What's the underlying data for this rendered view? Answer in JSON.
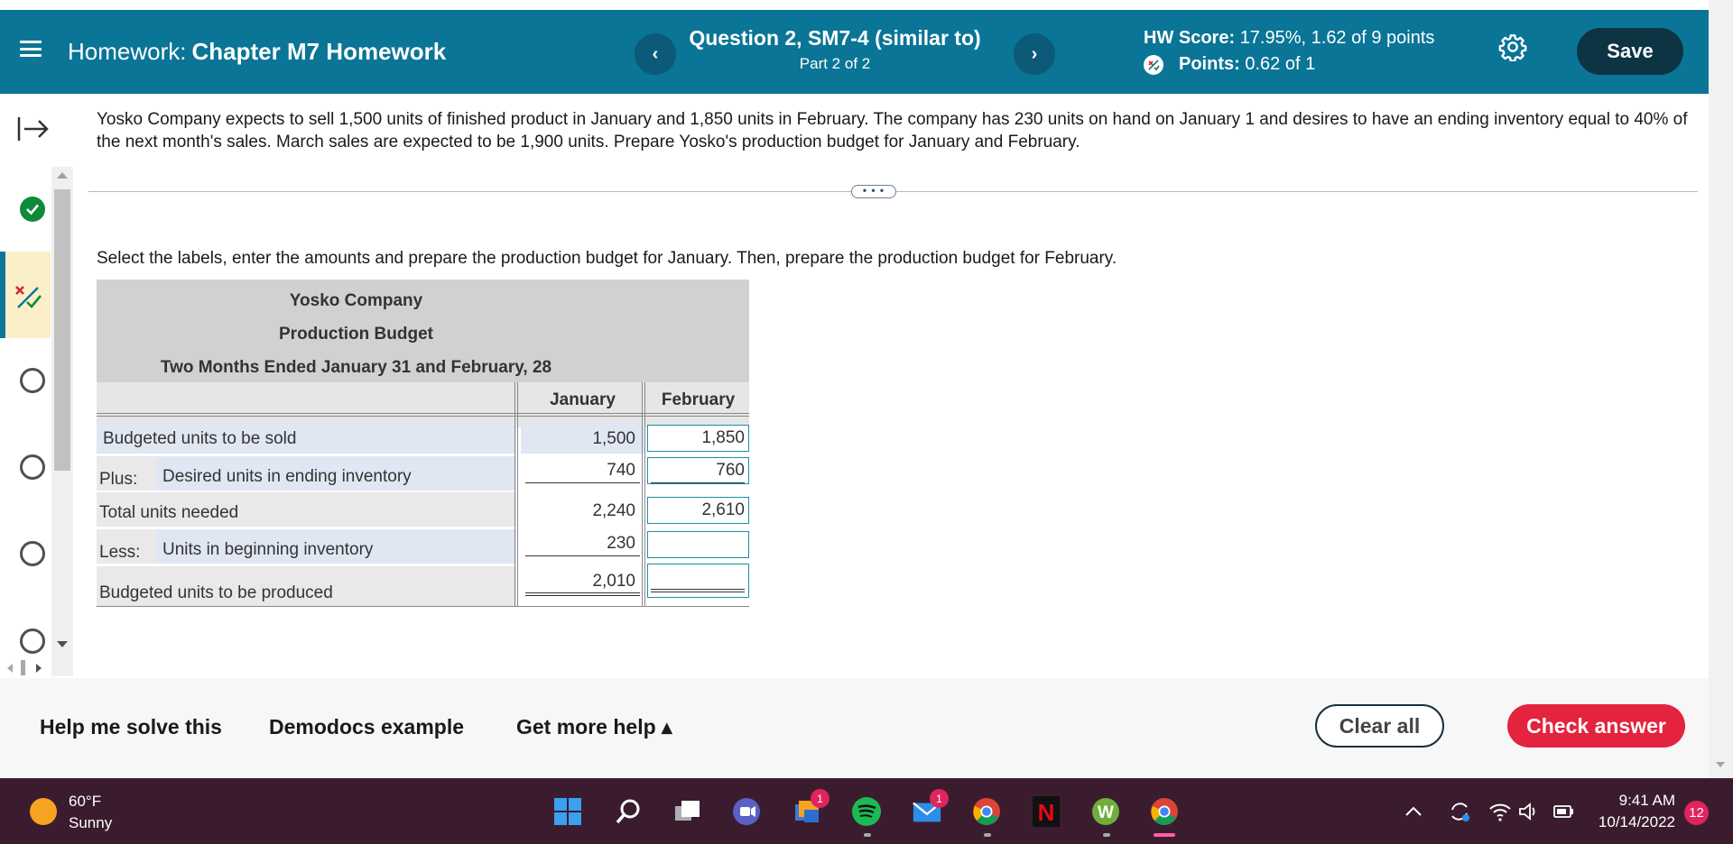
{
  "header": {
    "homework_prefix": "Homework:",
    "homework_name": "Chapter M7 Homework",
    "question_title": "Question 2, SM7-4 (similar to)",
    "question_part": "Part 2 of 2",
    "hw_score_label": "HW Score:",
    "hw_score_value": "17.95%, 1.62 of 9 points",
    "points_label": "Points:",
    "points_value": "0.62 of 1",
    "save_label": "Save",
    "prev_glyph": "‹",
    "next_glyph": "›",
    "accent_color": "#0a7596"
  },
  "sidebar": {
    "question_states": [
      "correct",
      "partial",
      "unanswered",
      "unanswered",
      "unanswered",
      "unanswered"
    ]
  },
  "problem": {
    "text": "Yosko Company expects to sell 1,500 units of finished product in January and 1,850 units in February. The company has 230 units on hand on January 1 and desires to have an ending inventory equal to 40% of the next month's sales. March sales are expected to be 1,900 units. Prepare Yosko's production budget for January and February.",
    "expand_glyph": "• • •",
    "instruction": "Select the labels, enter the amounts and prepare the production budget for January. Then, prepare the production budget for February."
  },
  "budget": {
    "company": "Yosko Company",
    "title": "Production Budget",
    "period": "Two Months Ended January 31 and February, 28",
    "col_jan": "January",
    "col_feb": "February",
    "rows": [
      {
        "prefix": "",
        "label": "Budgeted units to be sold",
        "jan": "1,500",
        "feb": "1,850"
      },
      {
        "prefix": "Plus:",
        "label": "Desired units in ending inventory",
        "jan": "740",
        "feb": "760"
      },
      {
        "prefix": "",
        "label": "Total units needed",
        "jan": "2,240",
        "feb": "2,610"
      },
      {
        "prefix": "Less:",
        "label": "Units in beginning inventory",
        "jan": "230",
        "feb": ""
      },
      {
        "prefix": "",
        "label": "Budgeted units to be produced",
        "jan": "2,010",
        "feb": ""
      }
    ]
  },
  "footer": {
    "help_solve": "Help me solve this",
    "demodocs": "Demodocs example",
    "more_help": "Get more help ▴",
    "clear_all": "Clear all",
    "check_answer": "Check answer",
    "check_color": "#e4233e"
  },
  "taskbar": {
    "temperature": "60°F",
    "weather": "Sunny",
    "time": "9:41 AM",
    "date": "10/14/2022",
    "notification_count": "12",
    "teams_badge": "1",
    "mail_badge": "1",
    "background_color": "#3b1c2e"
  }
}
